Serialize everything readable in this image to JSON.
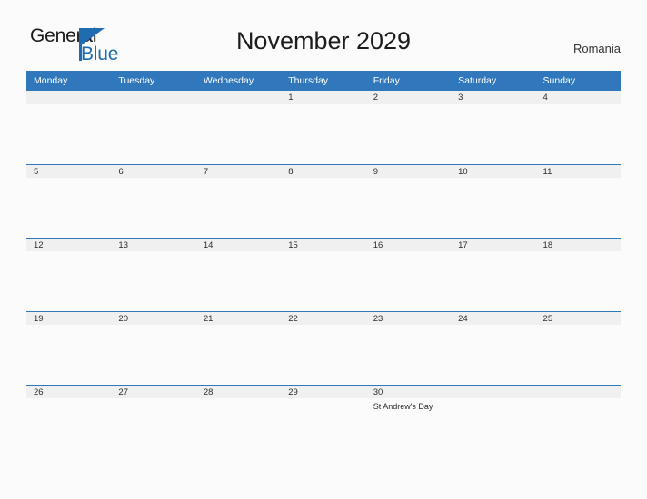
{
  "brand": {
    "word_one": "General",
    "word_two": "Blue",
    "triangle_icon": "brand-triangle-icon",
    "accent_color": "#1f6cb0"
  },
  "header": {
    "title": "November 2029",
    "country": "Romania"
  },
  "calendar": {
    "header_bg": "#3077bc",
    "band_bg": "#f0f0f0",
    "weekday_headers": [
      "Monday",
      "Tuesday",
      "Wednesday",
      "Thursday",
      "Friday",
      "Saturday",
      "Sunday"
    ],
    "weeks": [
      [
        {
          "day": ""
        },
        {
          "day": ""
        },
        {
          "day": ""
        },
        {
          "day": "1"
        },
        {
          "day": "2"
        },
        {
          "day": "3"
        },
        {
          "day": "4"
        }
      ],
      [
        {
          "day": "5"
        },
        {
          "day": "6"
        },
        {
          "day": "7"
        },
        {
          "day": "8"
        },
        {
          "day": "9"
        },
        {
          "day": "10"
        },
        {
          "day": "11"
        }
      ],
      [
        {
          "day": "12"
        },
        {
          "day": "13"
        },
        {
          "day": "14"
        },
        {
          "day": "15"
        },
        {
          "day": "16"
        },
        {
          "day": "17"
        },
        {
          "day": "18"
        }
      ],
      [
        {
          "day": "19"
        },
        {
          "day": "20"
        },
        {
          "day": "21"
        },
        {
          "day": "22"
        },
        {
          "day": "23"
        },
        {
          "day": "24"
        },
        {
          "day": "25"
        }
      ],
      [
        {
          "day": "26"
        },
        {
          "day": "27"
        },
        {
          "day": "28"
        },
        {
          "day": "29"
        },
        {
          "day": "30",
          "event": "St Andrew's Day"
        },
        {
          "day": ""
        },
        {
          "day": ""
        }
      ]
    ]
  }
}
